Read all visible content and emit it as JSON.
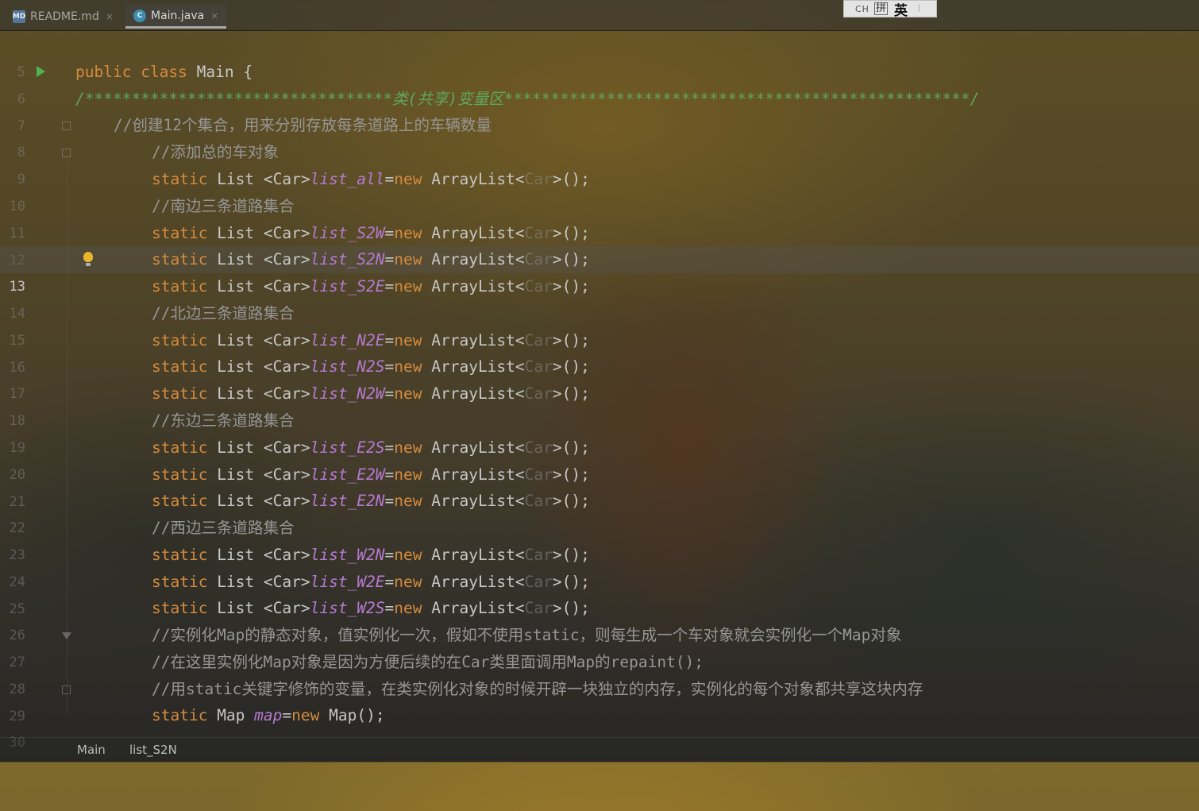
{
  "tabs": [
    {
      "label": "README.md",
      "icon": "markdown-file-icon",
      "icon_text": "MD",
      "close": "×"
    },
    {
      "label": "Main.java",
      "icon": "java-class-icon",
      "icon_text": "C",
      "close": "×"
    }
  ],
  "ime": {
    "mode": "CH",
    "pinyin": "拼",
    "lang": "英",
    "handle": "⋮"
  },
  "line_numbers": [
    "5",
    "6",
    "7",
    "8",
    "9",
    "10",
    "11",
    "12",
    "13",
    "14",
    "15",
    "16",
    "17",
    "18",
    "19",
    "20",
    "21",
    "22",
    "23",
    "24",
    "25",
    "26",
    "27",
    "28",
    "29",
    "30"
  ],
  "current_line": "13",
  "code": {
    "l6": {
      "kw1": "public",
      "kw2": "class",
      "name": " Main {"
    },
    "l7": "/*********************************类(共享)变量区**************************************************/",
    "l8": "//创建12个集合，用来分别存放每条道路上的车辆数量",
    "l9": "//添加总的车对象",
    "kw_static": "static",
    "type_list": " List <Car>",
    "kw_new": "new",
    "eq": "=",
    "ctor_open": " ArrayList<",
    "ctor_generic": "Car",
    "ctor_close": ">();",
    "fields": {
      "l10": "list_all",
      "l12": "list_S2W",
      "l13": "list_S2N",
      "l14": "list_S2E",
      "l16": "list_N2E",
      "l17": "list_N2S",
      "l18": "list_N2W",
      "l20": "list_E2S",
      "l21": "list_E2W",
      "l22": "list_E2N",
      "l24": "list_W2N",
      "l25": "list_W2E",
      "l26": "list_W2S"
    },
    "l11": "//南边三条道路集合",
    "l15": "//北边三条道路集合",
    "l19": "//东边三条道路集合",
    "l23": "//西边三条道路集合",
    "l27": "//实例化Map的静态对象，值实例化一次，假如不使用static，则每生成一个车对象就会实例化一个Map对象",
    "l28": "//在这里实例化Map对象是因为方便后续的在Car类里面调用Map的repaint();",
    "l29": "//用static关键字修饰的变量，在类实例化对象的时候开辟一块独立的内存，实例化的每个对象都共享这块内存",
    "l30": {
      "type": " Map ",
      "field": "map",
      "ctor": " Map();"
    }
  },
  "breadcrumb": [
    "Main",
    "list_S2N"
  ],
  "colors": {
    "keyword": "#d58b3d",
    "field": "#b57ad0",
    "comment": "#969696",
    "doc_comment": "#5fa75f",
    "text": "#c7c7c7"
  }
}
